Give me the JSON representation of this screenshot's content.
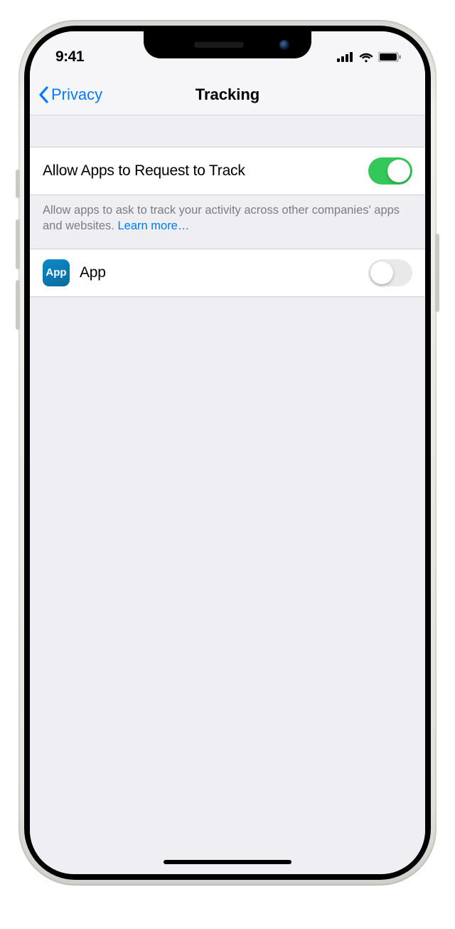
{
  "status": {
    "time": "9:41"
  },
  "nav": {
    "back_label": "Privacy",
    "title": "Tracking"
  },
  "settings": {
    "allow_apps": {
      "label": "Allow Apps to Request to Track",
      "on": true
    },
    "footer_text": "Allow apps to ask to track your activity across other companies' apps and websites. ",
    "learn_more": "Learn more…"
  },
  "apps": [
    {
      "icon_label": "App",
      "name": "App",
      "on": false
    }
  ],
  "colors": {
    "accent": "#007aff",
    "switch_on": "#34c759"
  }
}
